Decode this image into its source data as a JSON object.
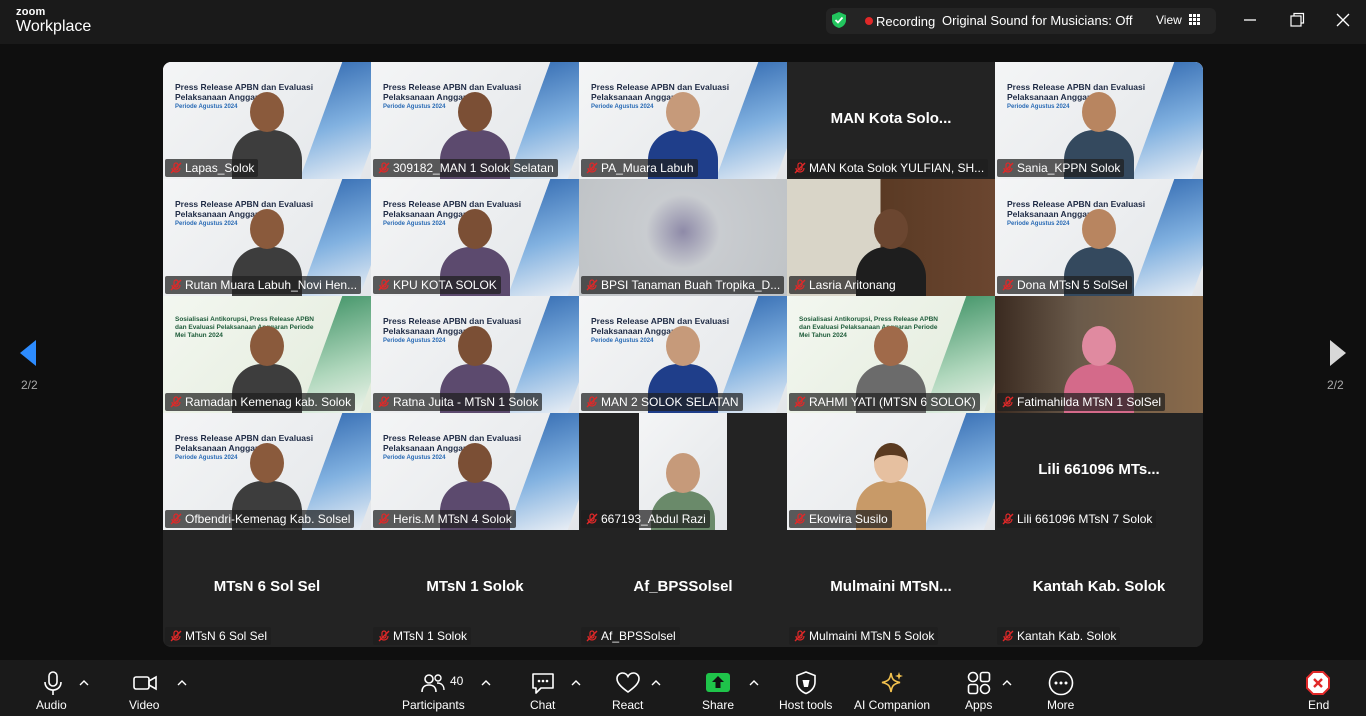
{
  "app": {
    "brand_line1": "zoom",
    "brand_line2": "Workplace"
  },
  "titlebar": {
    "recording_label": "Recording",
    "original_sound": "Original Sound for Musicians: Off",
    "view_label": "View"
  },
  "pagination": {
    "left": "2/2",
    "right": "2/2"
  },
  "tiles": [
    {
      "name": "Lapas_Solok",
      "kind": "slide"
    },
    {
      "name": "309182_MAN 1 Solok Selatan",
      "kind": "slide"
    },
    {
      "name": "PA_Muara Labuh",
      "kind": "slide"
    },
    {
      "name": "MAN Kota Solok YULFIAN, SH...",
      "kind": "name",
      "big": "MAN  Kota  Solo..."
    },
    {
      "name": "Sania_KPPN Solok",
      "kind": "slide"
    },
    {
      "name": "Rutan Muara Labuh_Novi Hen...",
      "kind": "slide"
    },
    {
      "name": "KPU KOTA SOLOK",
      "kind": "slide"
    },
    {
      "name": "BPSI Tanaman Buah Tropika_D...",
      "kind": "blur"
    },
    {
      "name": "Lasria Aritonang",
      "kind": "room"
    },
    {
      "name": "Dona MTsN 5 SolSel",
      "kind": "slide"
    },
    {
      "name": "Ramadan Kemenag kab. Solok",
      "kind": "slide-green"
    },
    {
      "name": "Ratna Juita - MTsN 1 Solok",
      "kind": "slide"
    },
    {
      "name": "MAN 2 SOLOK SELATAN",
      "kind": "slide"
    },
    {
      "name": "RAHMI YATI (MTSN 6 SOLOK)",
      "kind": "slide-green"
    },
    {
      "name": "Fatimahilda MTsN 1 SolSel",
      "kind": "room2"
    },
    {
      "name": "Ofbendri-Kemenag Kab. Solsel",
      "kind": "slide"
    },
    {
      "name": "Heris.M MTsN 4 Solok",
      "kind": "slide"
    },
    {
      "name": "667193_Abdul Razi",
      "kind": "narrow"
    },
    {
      "name": "Ekowira Susilo",
      "kind": "avatar"
    },
    {
      "name": "Lili 661096 MTsN 7 Solok",
      "kind": "name",
      "big": "Lili 661096 MTs..."
    },
    {
      "name": "MTsN 6 Sol Sel",
      "kind": "name",
      "big": "MTsN 6 Sol Sel"
    },
    {
      "name": "MTsN 1 Solok",
      "kind": "name",
      "big": "MTsN 1 Solok"
    },
    {
      "name": "Af_BPSSolsel",
      "kind": "name",
      "big": "Af_BPSSolsel"
    },
    {
      "name": "Mulmaini MTsN 5 Solok",
      "kind": "name",
      "big": "Mulmaini  MTsN..."
    },
    {
      "name": "Kantah Kab. Solok",
      "kind": "name",
      "big": "Kantah Kab. Solok"
    }
  ],
  "slide_text": {
    "title": "Press Release APBN dan Evaluasi Pelaksanaan Anggaran",
    "period": "Periode Agustus 2024",
    "title_green": "Sosialisasi Antikorupsi, Press Release APBN dan Evaluasi Pelaksanaan Anggaran Periode Mei Tahun 2024"
  },
  "toolbar": {
    "audio": "Audio",
    "video": "Video",
    "participants": "Participants",
    "participants_count": "40",
    "chat": "Chat",
    "react": "React",
    "share": "Share",
    "host_tools": "Host tools",
    "ai_companion": "AI Companion",
    "apps": "Apps",
    "more": "More",
    "end": "End"
  },
  "colors": {
    "share_green": "#1fc44a",
    "end_red": "#e02828",
    "ai_gold": "#f2c14e",
    "shield_green": "#22c55e"
  }
}
